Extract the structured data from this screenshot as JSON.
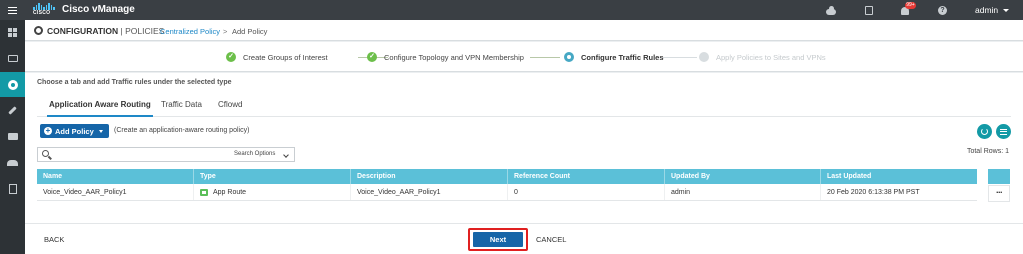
{
  "topbar": {
    "logo_word": "CISCO",
    "app_title": "Cisco vManage",
    "alert_count": "99+",
    "help_glyph": "?",
    "user": "admin",
    "icons": [
      "menu-icon",
      "cloud-icon",
      "task-icon",
      "bell-icon",
      "help-icon",
      "chevron-down-icon"
    ]
  },
  "sidebar": {
    "items": [
      {
        "icon": "dashboard-icon",
        "active": false
      },
      {
        "icon": "monitor-icon",
        "active": false
      },
      {
        "icon": "gear-icon",
        "active": true
      },
      {
        "icon": "wrench-icon",
        "active": false
      },
      {
        "icon": "briefcase-icon",
        "active": false
      },
      {
        "icon": "users-icon",
        "active": false
      },
      {
        "icon": "report-icon",
        "active": false
      }
    ]
  },
  "header": {
    "title": "CONFIGURATION",
    "subtitle": "| POLICIES",
    "breadcrumb_link": "Centralized Policy",
    "breadcrumb_sep": ">",
    "breadcrumb_current": "Add Policy"
  },
  "stepper": {
    "steps": [
      {
        "label": "Create Groups of Interest",
        "state": "done",
        "glyph": "✓"
      },
      {
        "label": "Configure Topology and VPN Membership",
        "state": "done",
        "glyph": "✓"
      },
      {
        "label": "Configure Traffic Rules",
        "state": "current",
        "glyph": ""
      },
      {
        "label": "Apply Policies to Sites and VPNs",
        "state": "todo",
        "glyph": ""
      }
    ]
  },
  "main": {
    "instruction": "Choose a tab and add Traffic rules under the selected type",
    "tabs": [
      {
        "label": "Application Aware Routing",
        "active": true
      },
      {
        "label": "Traffic Data",
        "active": false
      },
      {
        "label": "Cflowd",
        "active": false
      }
    ],
    "add_policy_label": "Add Policy",
    "add_policy_hint": "(Create an application-aware routing policy)",
    "plus_glyph": "+",
    "search": {
      "value": "",
      "placeholder": "",
      "options_label": "Search Options"
    },
    "total_rows": "Total Rows: 1",
    "table": {
      "columns": [
        "Name",
        "Type",
        "Description",
        "Reference Count",
        "Updated By",
        "Last Updated"
      ],
      "rows": [
        {
          "name": "Voice_Video_AAR_Policy1",
          "type": "App Route",
          "description": "Voice_Video_AAR_Policy1",
          "reference_count": "0",
          "updated_by": "admin",
          "last_updated": "20 Feb 2020 6:13:38 PM PST"
        }
      ],
      "row_actions_glyph": "..."
    }
  },
  "footer": {
    "back_label": "BACK",
    "next_label": "Next",
    "cancel_label": "CANCEL"
  },
  "colors": {
    "accent_teal": "#139aa6",
    "primary_blue": "#1565a8",
    "table_header": "#5bc0d8",
    "step_done": "#6cbf4a",
    "highlight_red": "#e02020"
  }
}
